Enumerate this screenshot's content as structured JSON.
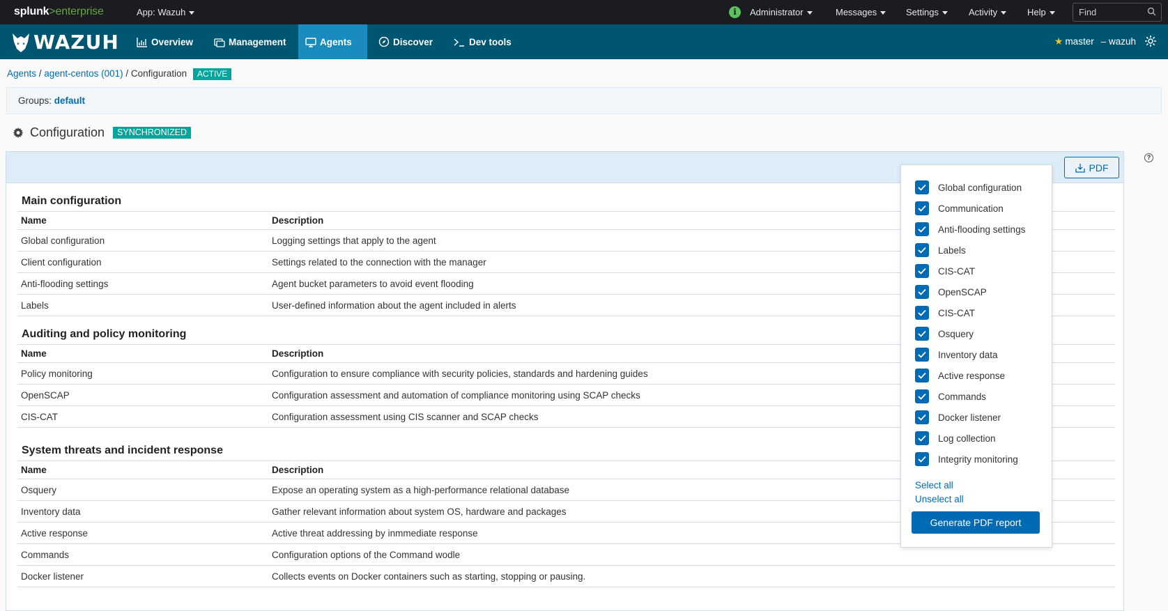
{
  "splunkbar": {
    "logo_splunk": "splunk",
    "logo_gt": ">",
    "logo_enterprise": "enterprise",
    "app_label": "App: Wazuh",
    "info_glyph": "i",
    "menus": [
      "Administrator",
      "Messages",
      "Settings",
      "Activity",
      "Help"
    ],
    "find_placeholder": "Find"
  },
  "wazuhbar": {
    "logo_text": "WAZUH",
    "nav": [
      {
        "label": "Overview",
        "icon": "chart-icon"
      },
      {
        "label": "Management",
        "icon": "management-icon"
      },
      {
        "label": "Agents",
        "icon": "monitor-icon",
        "active": true
      },
      {
        "label": "Discover",
        "icon": "compass-icon"
      },
      {
        "label": "Dev tools",
        "icon": "terminal-icon"
      }
    ],
    "api_label": "master",
    "api_sep": "– wazuh"
  },
  "breadcrumb": {
    "agents": "Agents",
    "sep1": " / ",
    "agent": "agent-centos (001)",
    "sep2": " / ",
    "current": "Configuration",
    "status": "ACTIVE"
  },
  "groups": {
    "label": "Groups: ",
    "value": "default"
  },
  "config_header": {
    "title": "Configuration",
    "status": "SYNCHRONIZED"
  },
  "pdf_button": "PDF",
  "sections": [
    {
      "title": "Main configuration",
      "headers": [
        "Name",
        "Description"
      ],
      "rows": [
        [
          "Global configuration",
          "Logging settings that apply to the agent"
        ],
        [
          "Client configuration",
          "Settings related to the connection with the manager"
        ],
        [
          "Anti-flooding settings",
          "Agent bucket parameters to avoid event flooding"
        ],
        [
          "Labels",
          "User-defined information about the agent included in alerts"
        ]
      ]
    },
    {
      "title": "Auditing and policy monitoring",
      "headers": [
        "Name",
        "Description"
      ],
      "rows": [
        [
          "Policy monitoring",
          "Configuration to ensure compliance with security policies, standards and hardening guides"
        ],
        [
          "OpenSCAP",
          "Configuration assessment and automation of compliance monitoring using SCAP checks"
        ],
        [
          "CIS-CAT",
          "Configuration assessment using CIS scanner and SCAP checks"
        ]
      ]
    },
    {
      "title": "System threats and incident response",
      "headers": [
        "Name",
        "Description"
      ],
      "rows": [
        [
          "Osquery",
          "Expose an operating system as a high-performance relational database"
        ],
        [
          "Inventory data",
          "Gather relevant information about system OS, hardware and packages"
        ],
        [
          "Active response",
          "Active threat addressing by inmmediate response"
        ],
        [
          "Commands",
          "Configuration options of the Command wodle"
        ],
        [
          "Docker listener",
          "Collects events on Docker containers such as starting, stopping or pausing."
        ]
      ]
    }
  ],
  "pdf_popover": {
    "options": [
      {
        "label": "Global configuration",
        "checked": true
      },
      {
        "label": "Communication",
        "checked": true
      },
      {
        "label": "Anti-flooding settings",
        "checked": true
      },
      {
        "label": "Labels",
        "checked": true
      },
      {
        "label": "CIS-CAT",
        "checked": true
      },
      {
        "label": "OpenSCAP",
        "checked": true
      },
      {
        "label": "CIS-CAT",
        "checked": true
      },
      {
        "label": "Osquery",
        "checked": true
      },
      {
        "label": "Inventory data",
        "checked": true
      },
      {
        "label": "Active response",
        "checked": true
      },
      {
        "label": "Commands",
        "checked": true
      },
      {
        "label": "Docker listener",
        "checked": true
      },
      {
        "label": "Log collection",
        "checked": true
      },
      {
        "label": "Integrity monitoring",
        "checked": true
      }
    ],
    "select_all": "Select all",
    "unselect_all": "Unselect all",
    "generate": "Generate PDF report"
  },
  "colors": {
    "wazuh_bar": "#005571",
    "active_nav": "#1a8bbd",
    "accent": "#006bb4",
    "badge": "#00a69b"
  }
}
